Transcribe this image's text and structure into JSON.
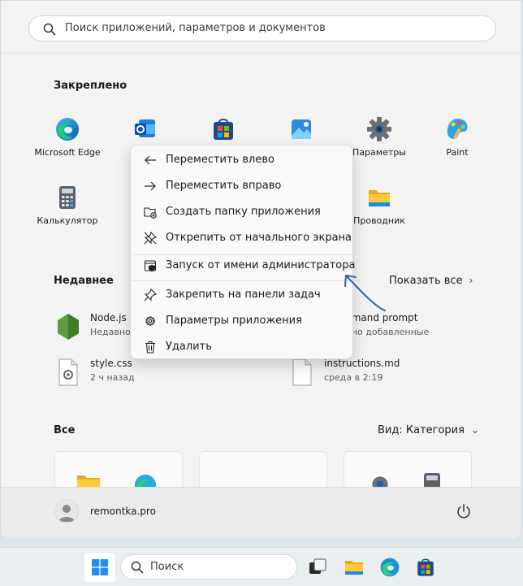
{
  "search": {
    "placeholder": "Поиск приложений, параметров и документов",
    "icon": "search-icon"
  },
  "pinned": {
    "title": "Закреплено",
    "apps": [
      {
        "label": "Microsoft Edge",
        "icon": "edge-icon"
      },
      {
        "label": "Outlook",
        "icon": "outlook-icon"
      },
      {
        "label": "Microsoft Store",
        "icon": "store-icon"
      },
      {
        "label": "Фотографии",
        "icon": "photos-icon"
      },
      {
        "label": "Параметры",
        "icon": "settings-gear-icon"
      },
      {
        "label": "Paint",
        "icon": "paint-icon"
      },
      {
        "label": "Калькулятор",
        "icon": "calculator-icon"
      },
      {
        "label": "Проводник",
        "icon": "explorer-folder-icon"
      }
    ]
  },
  "recent": {
    "title": "Недавнее",
    "show_all": "Показать все",
    "items": [
      {
        "name": "Node.js",
        "sub": "Недавно",
        "icon": "nodejs-icon"
      },
      {
        "name": "s command prompt",
        "sub": "Недавно добавленные",
        "icon": "cmd-icon"
      },
      {
        "name": "style.css",
        "sub": "2 ч назад",
        "icon": "css-file-icon"
      },
      {
        "name": "instructions.md",
        "sub": "среда в 2:19",
        "icon": "file-icon"
      }
    ]
  },
  "all": {
    "title": "Все",
    "view": "Вид: Категория"
  },
  "context_menu": {
    "items": [
      {
        "label": "Переместить влево",
        "icon": "arrow-left-icon"
      },
      {
        "label": "Переместить вправо",
        "icon": "arrow-right-icon"
      },
      {
        "label": "Создать папку приложения",
        "icon": "new-folder-icon"
      },
      {
        "label": "Открепить от начального экрана",
        "icon": "unpin-icon"
      },
      {
        "label": "Запуск от имени администратора",
        "icon": "admin-shield-icon"
      },
      {
        "label": "Закрепить на панели задач",
        "icon": "pin-icon"
      },
      {
        "label": "Параметры приложения",
        "icon": "gear-icon"
      },
      {
        "label": "Удалить",
        "icon": "trash-icon"
      }
    ]
  },
  "user": {
    "name": "remontka.pro"
  },
  "taskbar": {
    "search_label": "Поиск"
  },
  "colors": {
    "accent": "#0067c0",
    "menu_bg": "#f9f9f9",
    "start_bg": "#f3f3f3",
    "annotation_arrow": "#2f5f9e"
  }
}
